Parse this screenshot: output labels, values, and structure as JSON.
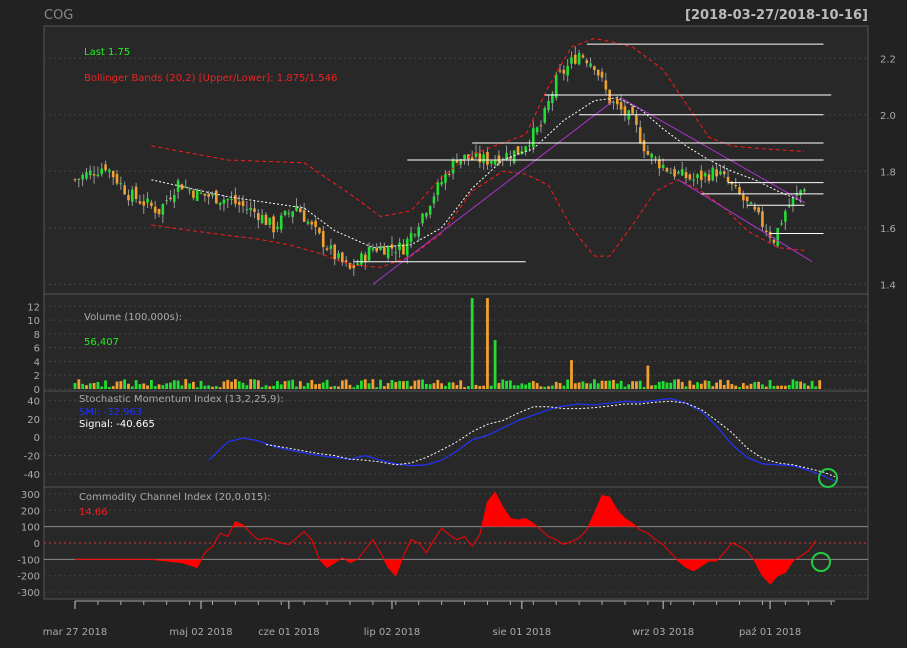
{
  "header": {
    "symbol": "COG",
    "date_range": "[2018-03-27/2018-10-16]"
  },
  "colors": {
    "background": "#222222",
    "panel": "#282828",
    "grid": "#444444",
    "up": "#22dd33",
    "down": "#f0a030",
    "bbands": "#ff1a1a",
    "sma": "#ffffff",
    "smi": "#2233ee",
    "signal": "#ffffff",
    "cci": "#ff0000",
    "trend": "#aa33cc",
    "level": "#ffffff",
    "circle": "#22cc44",
    "text_gray": "#aaaaaa",
    "last_green": "#22ee22",
    "bb_label": "#ee2222"
  },
  "chart_data": [
    {
      "type": "candlestick",
      "title": "COG",
      "ylim": [
        1.38,
        2.3
      ],
      "yticks": [
        "1.4",
        "1.6",
        "1.8",
        "2.0",
        "2.2"
      ],
      "legend": {
        "last": "Last 1.75",
        "bbands": "Bollinger Bands (20,2) [Upper/Lower]: 1.875/1.546"
      },
      "ohlc_anchors": [
        {
          "i": 0,
          "c": 1.77
        },
        {
          "i": 8,
          "c": 1.82
        },
        {
          "i": 14,
          "c": 1.72
        },
        {
          "i": 22,
          "c": 1.66
        },
        {
          "i": 27,
          "c": 1.76
        },
        {
          "i": 32,
          "c": 1.72
        },
        {
          "i": 40,
          "c": 1.7
        },
        {
          "i": 48,
          "c": 1.65
        },
        {
          "i": 52,
          "c": 1.6
        },
        {
          "i": 58,
          "c": 1.68
        },
        {
          "i": 62,
          "c": 1.6
        },
        {
          "i": 68,
          "c": 1.5
        },
        {
          "i": 72,
          "c": 1.45
        },
        {
          "i": 78,
          "c": 1.53
        },
        {
          "i": 86,
          "c": 1.53
        },
        {
          "i": 94,
          "c": 1.72
        },
        {
          "i": 100,
          "c": 1.85
        },
        {
          "i": 108,
          "c": 1.84
        },
        {
          "i": 116,
          "c": 1.87
        },
        {
          "i": 122,
          "c": 1.96
        },
        {
          "i": 126,
          "c": 2.12
        },
        {
          "i": 132,
          "c": 2.22
        },
        {
          "i": 136,
          "c": 2.18
        },
        {
          "i": 140,
          "c": 2.05
        },
        {
          "i": 146,
          "c": 1.98
        },
        {
          "i": 150,
          "c": 1.86
        },
        {
          "i": 156,
          "c": 1.8
        },
        {
          "i": 162,
          "c": 1.77
        },
        {
          "i": 168,
          "c": 1.8
        },
        {
          "i": 173,
          "c": 1.73
        },
        {
          "i": 178,
          "c": 1.65
        },
        {
          "i": 183,
          "c": 1.56
        },
        {
          "i": 186,
          "c": 1.66
        },
        {
          "i": 191,
          "c": 1.75
        }
      ],
      "overlays": {
        "bb_upper": [
          [
            20,
            1.89
          ],
          [
            40,
            1.84
          ],
          [
            60,
            1.83
          ],
          [
            72,
            1.72
          ],
          [
            80,
            1.64
          ],
          [
            88,
            1.66
          ],
          [
            96,
            1.78
          ],
          [
            104,
            1.86
          ],
          [
            112,
            1.9
          ],
          [
            118,
            1.93
          ],
          [
            124,
            2.1
          ],
          [
            130,
            2.24
          ],
          [
            136,
            2.27
          ],
          [
            140,
            2.26
          ],
          [
            146,
            2.24
          ],
          [
            150,
            2.2
          ],
          [
            154,
            2.16
          ],
          [
            158,
            2.08
          ],
          [
            162,
            2.0
          ],
          [
            166,
            1.92
          ],
          [
            172,
            1.89
          ],
          [
            180,
            1.88
          ],
          [
            191,
            1.87
          ]
        ],
        "bb_lower": [
          [
            20,
            1.61
          ],
          [
            36,
            1.58
          ],
          [
            48,
            1.56
          ],
          [
            56,
            1.54
          ],
          [
            64,
            1.51
          ],
          [
            72,
            1.47
          ],
          [
            80,
            1.46
          ],
          [
            88,
            1.5
          ],
          [
            96,
            1.58
          ],
          [
            104,
            1.73
          ],
          [
            112,
            1.8
          ],
          [
            118,
            1.79
          ],
          [
            124,
            1.75
          ],
          [
            130,
            1.6
          ],
          [
            136,
            1.5
          ],
          [
            140,
            1.5
          ],
          [
            146,
            1.61
          ],
          [
            152,
            1.73
          ],
          [
            158,
            1.77
          ],
          [
            164,
            1.73
          ],
          [
            170,
            1.67
          ],
          [
            176,
            1.59
          ],
          [
            184,
            1.53
          ],
          [
            191,
            1.52
          ]
        ],
        "sma": [
          [
            20,
            1.77
          ],
          [
            40,
            1.71
          ],
          [
            60,
            1.67
          ],
          [
            68,
            1.59
          ],
          [
            78,
            1.53
          ],
          [
            88,
            1.54
          ],
          [
            96,
            1.6
          ],
          [
            104,
            1.74
          ],
          [
            112,
            1.84
          ],
          [
            120,
            1.88
          ],
          [
            128,
            1.98
          ],
          [
            136,
            2.05
          ],
          [
            142,
            2.06
          ],
          [
            148,
            2.02
          ],
          [
            154,
            1.95
          ],
          [
            160,
            1.89
          ],
          [
            166,
            1.84
          ],
          [
            172,
            1.8
          ],
          [
            178,
            1.77
          ],
          [
            184,
            1.73
          ],
          [
            191,
            1.69
          ]
        ]
      },
      "trend_lines": [
        [
          [
            78,
            1.4
          ],
          [
            141,
            2.05
          ]
        ],
        [
          [
            143,
            2.06
          ],
          [
            191,
            1.69
          ]
        ],
        [
          [
            158,
            1.77
          ],
          [
            193,
            1.48
          ]
        ]
      ],
      "levels": [
        [
          [
            73,
            1.48
          ],
          [
            118,
            1.48
          ]
        ],
        [
          [
            87,
            1.84
          ],
          [
            196,
            1.84
          ]
        ],
        [
          [
            104,
            1.9
          ],
          [
            196,
            1.9
          ]
        ],
        [
          [
            132,
            2.0
          ],
          [
            196,
            2.0
          ]
        ],
        [
          [
            123,
            2.07
          ],
          [
            198,
            2.07
          ]
        ],
        [
          [
            134,
            2.25
          ],
          [
            196,
            2.25
          ]
        ],
        [
          [
            164,
            1.72
          ],
          [
            196,
            1.72
          ]
        ],
        [
          [
            171,
            1.76
          ],
          [
            196,
            1.76
          ]
        ],
        [
          [
            176,
            1.68
          ],
          [
            191,
            1.68
          ]
        ],
        [
          [
            182,
            1.58
          ],
          [
            196,
            1.58
          ]
        ]
      ]
    },
    {
      "type": "bar",
      "name": "Volume",
      "label": "Volume (100,000s):",
      "last_value": "56,407",
      "ylim": [
        0,
        13.5
      ],
      "yticks": [
        "0",
        "2",
        "4",
        "6",
        "8",
        "10",
        "12"
      ],
      "spikes": [
        {
          "i": 104,
          "v": 13.2
        },
        {
          "i": 108,
          "v": 13.2
        },
        {
          "i": 110,
          "v": 7.1
        },
        {
          "i": 130,
          "v": 4.2
        },
        {
          "i": 150,
          "v": 3.4
        }
      ]
    },
    {
      "type": "line",
      "name": "Stochastic Momentum Index",
      "label": "Stochastic Momentum Index (13,2,25,9):",
      "smi_label": "SMI: -32.963",
      "signal_label": "Signal: -40.665",
      "ylim": [
        -52,
        48
      ],
      "yticks": [
        "-40",
        "-20",
        "0",
        "20",
        "40"
      ],
      "smi": [
        [
          35,
          -25
        ],
        [
          40,
          -5
        ],
        [
          44,
          -1
        ],
        [
          48,
          -4
        ],
        [
          52,
          -10
        ],
        [
          56,
          -14
        ],
        [
          60,
          -17
        ],
        [
          64,
          -20
        ],
        [
          68,
          -22
        ],
        [
          72,
          -24
        ],
        [
          76,
          -20
        ],
        [
          80,
          -25
        ],
        [
          84,
          -29
        ],
        [
          88,
          -31
        ],
        [
          92,
          -30
        ],
        [
          96,
          -25
        ],
        [
          100,
          -15
        ],
        [
          104,
          -3
        ],
        [
          108,
          2
        ],
        [
          112,
          10
        ],
        [
          116,
          18
        ],
        [
          120,
          24
        ],
        [
          124,
          30
        ],
        [
          128,
          34
        ],
        [
          132,
          36
        ],
        [
          136,
          35
        ],
        [
          140,
          37
        ],
        [
          144,
          39
        ],
        [
          148,
          38
        ],
        [
          152,
          40
        ],
        [
          156,
          42
        ],
        [
          160,
          37
        ],
        [
          164,
          28
        ],
        [
          168,
          12
        ],
        [
          172,
          -8
        ],
        [
          176,
          -22
        ],
        [
          180,
          -29
        ],
        [
          184,
          -30
        ],
        [
          188,
          -31
        ],
        [
          192,
          -36
        ],
        [
          196,
          -42
        ],
        [
          199,
          -48
        ]
      ],
      "signal": [
        [
          50,
          -8
        ],
        [
          56,
          -12
        ],
        [
          60,
          -15
        ],
        [
          64,
          -18
        ],
        [
          68,
          -20
        ],
        [
          72,
          -24
        ],
        [
          76,
          -25
        ],
        [
          80,
          -27
        ],
        [
          84,
          -30
        ],
        [
          88,
          -28
        ],
        [
          92,
          -22
        ],
        [
          96,
          -14
        ],
        [
          100,
          -5
        ],
        [
          104,
          6
        ],
        [
          108,
          14
        ],
        [
          112,
          18
        ],
        [
          116,
          26
        ],
        [
          120,
          33
        ],
        [
          124,
          33
        ],
        [
          128,
          31
        ],
        [
          132,
          31
        ],
        [
          136,
          32
        ],
        [
          140,
          34
        ],
        [
          144,
          36
        ],
        [
          148,
          36
        ],
        [
          152,
          38
        ],
        [
          156,
          39
        ],
        [
          160,
          37
        ],
        [
          164,
          30
        ],
        [
          168,
          18
        ],
        [
          172,
          5
        ],
        [
          176,
          -12
        ],
        [
          180,
          -23
        ],
        [
          184,
          -28
        ],
        [
          188,
          -30
        ],
        [
          192,
          -34
        ],
        [
          196,
          -38
        ],
        [
          199,
          -43
        ]
      ]
    },
    {
      "type": "area",
      "name": "Commodity Channel Index",
      "label": "Commodity Channel Index (20,0.015):",
      "last_label": "14.66",
      "ylim": [
        -330,
        330
      ],
      "yticks": [
        "-300",
        "-200",
        "-100",
        "0",
        "100",
        "200",
        "300"
      ],
      "cci": [
        [
          0,
          -100
        ],
        [
          10,
          -100
        ],
        [
          20,
          -100
        ],
        [
          28,
          -120
        ],
        [
          32,
          -150
        ],
        [
          34,
          -60
        ],
        [
          36,
          -20
        ],
        [
          38,
          60
        ],
        [
          40,
          40
        ],
        [
          42,
          130
        ],
        [
          44,
          110
        ],
        [
          46,
          60
        ],
        [
          48,
          20
        ],
        [
          50,
          30
        ],
        [
          52,
          20
        ],
        [
          54,
          0
        ],
        [
          56,
          -10
        ],
        [
          58,
          30
        ],
        [
          60,
          70
        ],
        [
          62,
          20
        ],
        [
          64,
          -100
        ],
        [
          66,
          -150
        ],
        [
          68,
          -120
        ],
        [
          70,
          -90
        ],
        [
          72,
          -120
        ],
        [
          74,
          -100
        ],
        [
          76,
          -40
        ],
        [
          78,
          20
        ],
        [
          80,
          -60
        ],
        [
          82,
          -150
        ],
        [
          84,
          -200
        ],
        [
          86,
          -80
        ],
        [
          88,
          20
        ],
        [
          90,
          0
        ],
        [
          92,
          -60
        ],
        [
          94,
          20
        ],
        [
          96,
          90
        ],
        [
          98,
          50
        ],
        [
          100,
          20
        ],
        [
          102,
          40
        ],
        [
          104,
          -20
        ],
        [
          106,
          50
        ],
        [
          108,
          250
        ],
        [
          110,
          310
        ],
        [
          112,
          220
        ],
        [
          114,
          150
        ],
        [
          116,
          140
        ],
        [
          118,
          150
        ],
        [
          120,
          120
        ],
        [
          122,
          80
        ],
        [
          124,
          40
        ],
        [
          126,
          20
        ],
        [
          128,
          -10
        ],
        [
          130,
          10
        ],
        [
          132,
          30
        ],
        [
          134,
          80
        ],
        [
          136,
          180
        ],
        [
          138,
          290
        ],
        [
          140,
          280
        ],
        [
          142,
          200
        ],
        [
          144,
          150
        ],
        [
          146,
          120
        ],
        [
          148,
          80
        ],
        [
          150,
          60
        ],
        [
          152,
          20
        ],
        [
          154,
          -10
        ],
        [
          156,
          -60
        ],
        [
          158,
          -110
        ],
        [
          160,
          -150
        ],
        [
          162,
          -170
        ],
        [
          164,
          -140
        ],
        [
          166,
          -110
        ],
        [
          168,
          -110
        ],
        [
          170,
          -60
        ],
        [
          172,
          0
        ],
        [
          174,
          -20
        ],
        [
          176,
          -50
        ],
        [
          178,
          -110
        ],
        [
          180,
          -200
        ],
        [
          182,
          -250
        ],
        [
          184,
          -200
        ],
        [
          186,
          -180
        ],
        [
          188,
          -110
        ],
        [
          190,
          -80
        ],
        [
          192,
          -50
        ],
        [
          194,
          15
        ]
      ]
    }
  ],
  "xaxis": {
    "count": 200,
    "labels": [
      "mar 27 2018",
      "maj 02 2018",
      "cze 01 2018",
      "lip 02 2018",
      "sie 01 2018",
      "wrz 03 2018",
      "paź 01 2018"
    ],
    "label_index": [
      0,
      33,
      56,
      83,
      117,
      154,
      182
    ]
  }
}
